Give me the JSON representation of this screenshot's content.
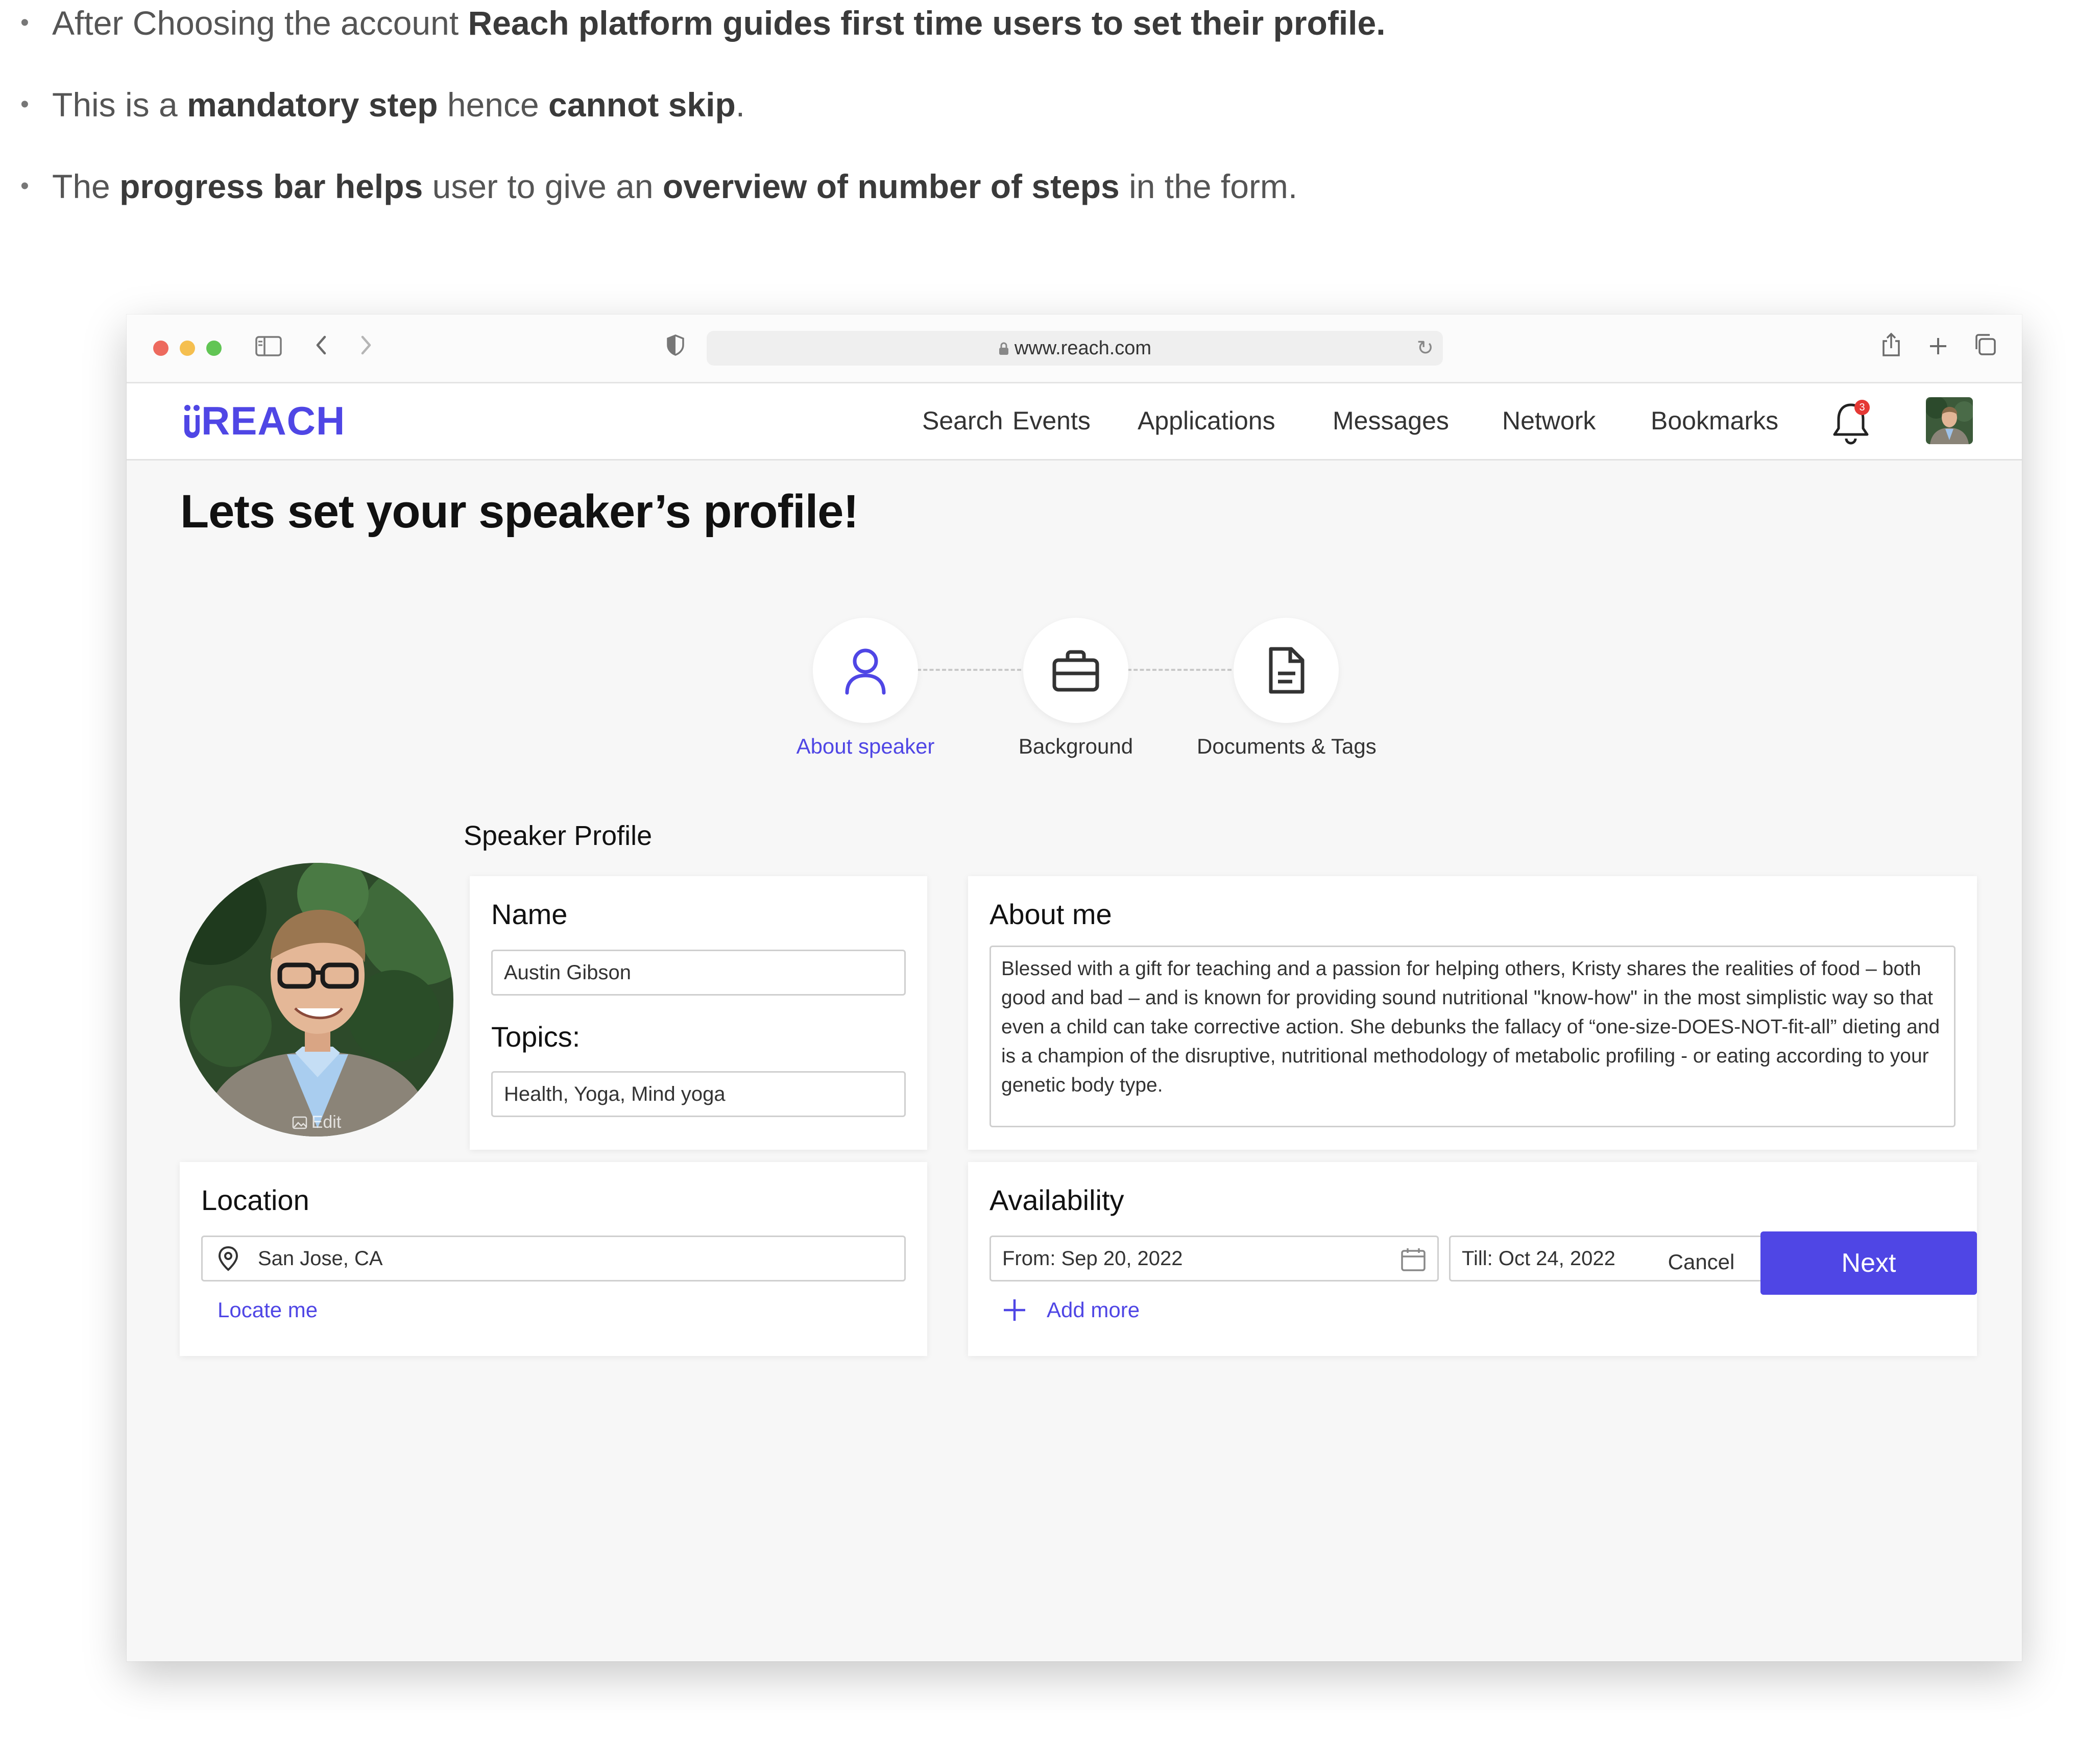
{
  "notes": [
    {
      "segments": [
        {
          "text": "After Choosing the account ",
          "bold": false
        },
        {
          "text": "Reach platform guides first time users to set their profile.",
          "bold": true
        }
      ]
    },
    {
      "segments": [
        {
          "text": "This is a ",
          "bold": false
        },
        {
          "text": "mandatory step",
          "bold": true
        },
        {
          "text": " hence ",
          "bold": false
        },
        {
          "text": "cannot skip",
          "bold": true
        },
        {
          "text": ".",
          "bold": false
        }
      ]
    },
    {
      "segments": [
        {
          "text": "The ",
          "bold": false
        },
        {
          "text": "progress bar helps",
          "bold": true
        },
        {
          "text": " user to give an ",
          "bold": false
        },
        {
          "text": "overview of number of steps",
          "bold": true
        },
        {
          "text": " in the form.",
          "bold": false
        }
      ]
    }
  ],
  "browser": {
    "url": "www.reach.com",
    "traffic_light_colors": [
      "#ed6a5e",
      "#f5bf4f",
      "#61c554"
    ]
  },
  "nav": {
    "logo": "REACH",
    "links": [
      "Search",
      "Events",
      "Applications",
      "Messages",
      "Network",
      "Bookmarks"
    ],
    "notification_count": "3"
  },
  "page": {
    "title": "Lets set your speaker’s  profile!",
    "steps": [
      {
        "label": "About speaker",
        "icon": "user-icon",
        "active": true
      },
      {
        "label": "Background",
        "icon": "briefcase-icon",
        "active": false
      },
      {
        "label": "Documents & Tags",
        "icon": "document-icon",
        "active": false
      }
    ],
    "section_title": "Speaker Profile",
    "avatar_edit_label": "Edit",
    "name": {
      "label": "Name",
      "value": "Austin Gibson"
    },
    "topics": {
      "label": "Topics:",
      "value": "Health, Yoga, Mind yoga"
    },
    "about": {
      "label": "About me",
      "value": "Blessed with a gift for teaching and a passion for helping others, Kristy shares the realities of food – both good and bad – and is known for providing sound nutritional \"know-how\" in the most simplistic way so that even a child can take corrective action. She debunks the fallacy of “one-size-DOES-NOT-fit-all” dieting and is a champion of the disruptive, nutritional methodology of metabolic profiling - or eating according to your genetic body type."
    },
    "location": {
      "label": "Location",
      "value": "San Jose, CA",
      "locate_link": "Locate me"
    },
    "availability": {
      "label": "Availability",
      "from": "From: Sep 20, 2022",
      "till": "Till: Oct 24, 2022",
      "add_more": "Add more"
    },
    "cancel_label": "Cancel",
    "next_label": "Next"
  },
  "colors": {
    "accent": "#4f46e5",
    "badge": "#e53935"
  }
}
